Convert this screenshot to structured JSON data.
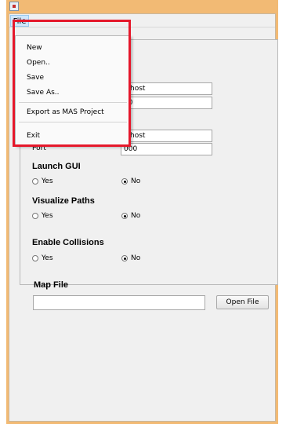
{
  "menubar": {
    "file_label": "File"
  },
  "file_menu": {
    "items": [
      "New",
      "Open..",
      "Save",
      "Save As..",
      "Export as MAS Project",
      "Exit"
    ]
  },
  "fields": {
    "host1_value": "alhost",
    "port1_value": "00",
    "host2_value": "alhost",
    "port2_label": "Port",
    "port2_value": "000"
  },
  "sections": {
    "launch_gui": {
      "title": "Launch GUI",
      "yes": "Yes",
      "no": "No",
      "selected": "No"
    },
    "visualize_paths": {
      "title": "Visualize Paths",
      "yes": "Yes",
      "no": "No",
      "selected": "No"
    },
    "enable_collisions": {
      "title": "Enable Collisions",
      "yes": "Yes",
      "no": "No",
      "selected": "No"
    },
    "map_file": {
      "title": "Map File",
      "path_value": "",
      "open_button": "Open File"
    }
  },
  "colors": {
    "window_frame": "#f2ba74",
    "highlight": "#e5182b",
    "menu_hover": "#cfe6fb"
  },
  "icons": {
    "app": "java-app-icon"
  }
}
